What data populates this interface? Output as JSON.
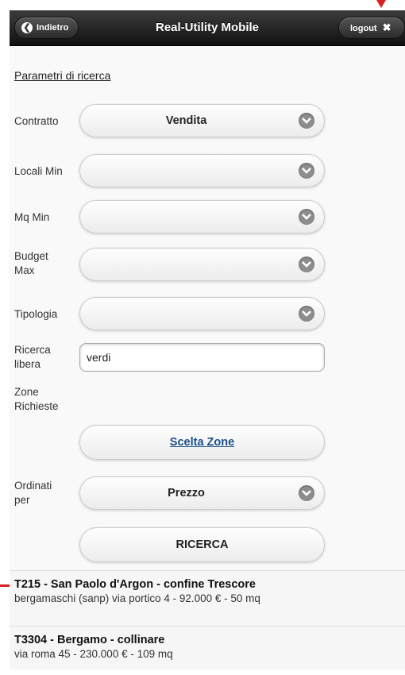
{
  "header": {
    "back_label": "Indietro",
    "title": "Real-Utility Mobile",
    "logout_label": "logout"
  },
  "form": {
    "section_title": "Parametri di ricerca",
    "contratto": {
      "label": "Contratto",
      "value": "Vendita"
    },
    "locali_min": {
      "label": "Locali Min",
      "value": ""
    },
    "mq_min": {
      "label": "Mq Min",
      "value": ""
    },
    "budget_max": {
      "label_line1": "Budget",
      "label_line2": "Max",
      "value": ""
    },
    "tipologia": {
      "label": "Tipologia",
      "value": ""
    },
    "ricerca_libera": {
      "label_line1": "Ricerca",
      "label_line2": "libera",
      "value": "verdi"
    },
    "zone_richieste": {
      "label_line1": "Zone",
      "label_line2": "Richieste",
      "button_label": "Scelta Zone"
    },
    "ordinati_per": {
      "label_line1": "Ordinati",
      "label_line2": "per",
      "value": "Prezzo"
    },
    "search_button": "RICERCA"
  },
  "results": [
    {
      "title": "T215 - San Paolo d'Argon - confine Trescore",
      "subtitle": "bergamaschi (sanp) via portico 4 - 92.000 € - 50 mq"
    },
    {
      "title": "T3304 - Bergamo - collinare",
      "subtitle": "via roma 45 - 230.000 € - 109 mq"
    }
  ],
  "colors": {
    "accent_marker": "#d62020",
    "header_bg": "#1e1e1e",
    "link": "#1a4f8a"
  }
}
